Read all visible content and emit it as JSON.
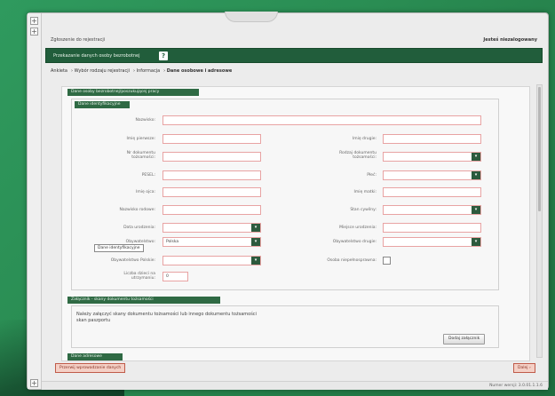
{
  "header": {
    "left": "Zgłoszenie do rejestracji",
    "right": "Jesteś niezalogowany"
  },
  "green_bar": {
    "title": "Przekazanie danych osoby bezrobotnej",
    "badge": "?"
  },
  "breadcrumb": [
    "Ankieta",
    "Wybór rodzaju rejestracji",
    "Informacja",
    "Dane osobowe i adresowe"
  ],
  "section_main": {
    "title": "Dane osoby bezrobotnej/poszukującej pracy"
  },
  "subsection": {
    "title": "Dane identyfikacyjne"
  },
  "form": {
    "nazwisko": {
      "label": "Nazwisko:",
      "value": ""
    },
    "imie_pierwsze": {
      "label": "Imię pierwsze:",
      "value": ""
    },
    "imie_drugie": {
      "label": "Imię drugie:",
      "value": ""
    },
    "nr_dokumentu": {
      "label": "Nr dokumentu tożsamości:",
      "value": ""
    },
    "rodzaj_dokumentu": {
      "label": "Rodzaj dokumentu tożsamości:",
      "value": ""
    },
    "pesel": {
      "label": "PESEL:",
      "value": ""
    },
    "plec": {
      "label": "Płeć:",
      "value": ""
    },
    "imie_ojca": {
      "label": "Imię ojca:",
      "value": ""
    },
    "imie_matki": {
      "label": "Imię matki:",
      "value": ""
    },
    "nazwisko_rodowe": {
      "label": "Nazwisko rodowe:",
      "value": ""
    },
    "stan_cywilny": {
      "label": "Stan cywilny:",
      "value": ""
    },
    "data_urodzenia": {
      "label": "Data urodzenia:",
      "value": ""
    },
    "miejsce_urodzenia": {
      "label": "Miejsce urodzenia:",
      "value": ""
    },
    "obywatelstwo": {
      "label": "Obywatelstwo:",
      "value": "Polska"
    },
    "obywatelstwo_drugie": {
      "label": "Obywatelstwo drugie:",
      "value": ""
    },
    "obywatelstwo_polskie": {
      "label": "Obywatelstwo Polskie:",
      "value": ""
    },
    "osoba_niepelnosprawna": {
      "label": "Osoba niepełnosprawna:"
    },
    "liczba_dzieci": {
      "label": "Liczba dzieci na utrzymaniu:",
      "value": "0"
    }
  },
  "tooltip": "Dane identyfikacyjne",
  "section_attachments": {
    "title": "Załącznik - skany dokumentu tożsamości",
    "text_line1": "Należy załączyć skany dokumentu tożsamości lub innego dokumentu tożsamości",
    "text_line2": "skan paszportu",
    "add_button": "Dodaj załącznik"
  },
  "section_next": {
    "title": "Dane adresowe"
  },
  "footer": {
    "prev_button": "Przerwij wprowadzanie danych",
    "next_button": "Dalej",
    "version": "Numer wersji: 3.0.01.1.1.6"
  }
}
